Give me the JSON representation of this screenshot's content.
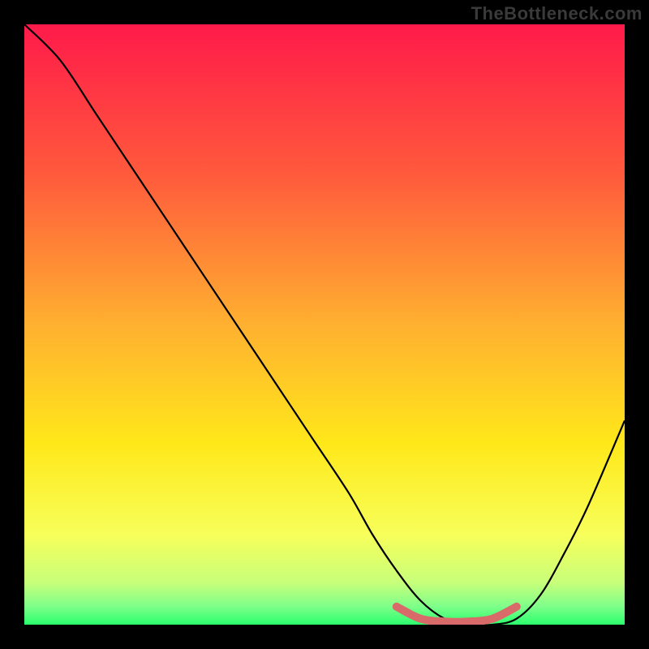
{
  "watermark": "TheBottleneck.com",
  "chart_data": {
    "type": "line",
    "title": "",
    "xlabel": "",
    "ylabel": "",
    "xlim": [
      0,
      100
    ],
    "ylim": [
      0,
      100
    ],
    "grid": false,
    "series": [
      {
        "name": "bottleneck-curve",
        "x": [
          0,
          6,
          12,
          18,
          24,
          30,
          36,
          42,
          48,
          54,
          58,
          62,
          66,
          70,
          74,
          78,
          82,
          86,
          90,
          94,
          100
        ],
        "values": [
          100,
          94,
          85,
          76,
          67,
          58,
          49,
          40,
          31,
          22,
          15,
          9,
          4,
          1,
          0,
          0,
          1,
          5,
          12,
          20,
          34
        ]
      },
      {
        "name": "optimal-range-marker",
        "x": [
          62,
          66,
          70,
          74,
          78,
          82
        ],
        "values": [
          3,
          1,
          0.5,
          0.5,
          1,
          3
        ]
      }
    ],
    "gradient_stops": [
      {
        "offset": 0.0,
        "color": "#ff1a4a"
      },
      {
        "offset": 0.25,
        "color": "#ff5a3c"
      },
      {
        "offset": 0.5,
        "color": "#ffb030"
      },
      {
        "offset": 0.7,
        "color": "#ffe81a"
      },
      {
        "offset": 0.85,
        "color": "#f7ff5a"
      },
      {
        "offset": 0.93,
        "color": "#c8ff7a"
      },
      {
        "offset": 0.97,
        "color": "#7dff8a"
      },
      {
        "offset": 1.0,
        "color": "#2bff6e"
      }
    ],
    "marker_color": "#d96a6a",
    "curve_color": "#000000"
  }
}
